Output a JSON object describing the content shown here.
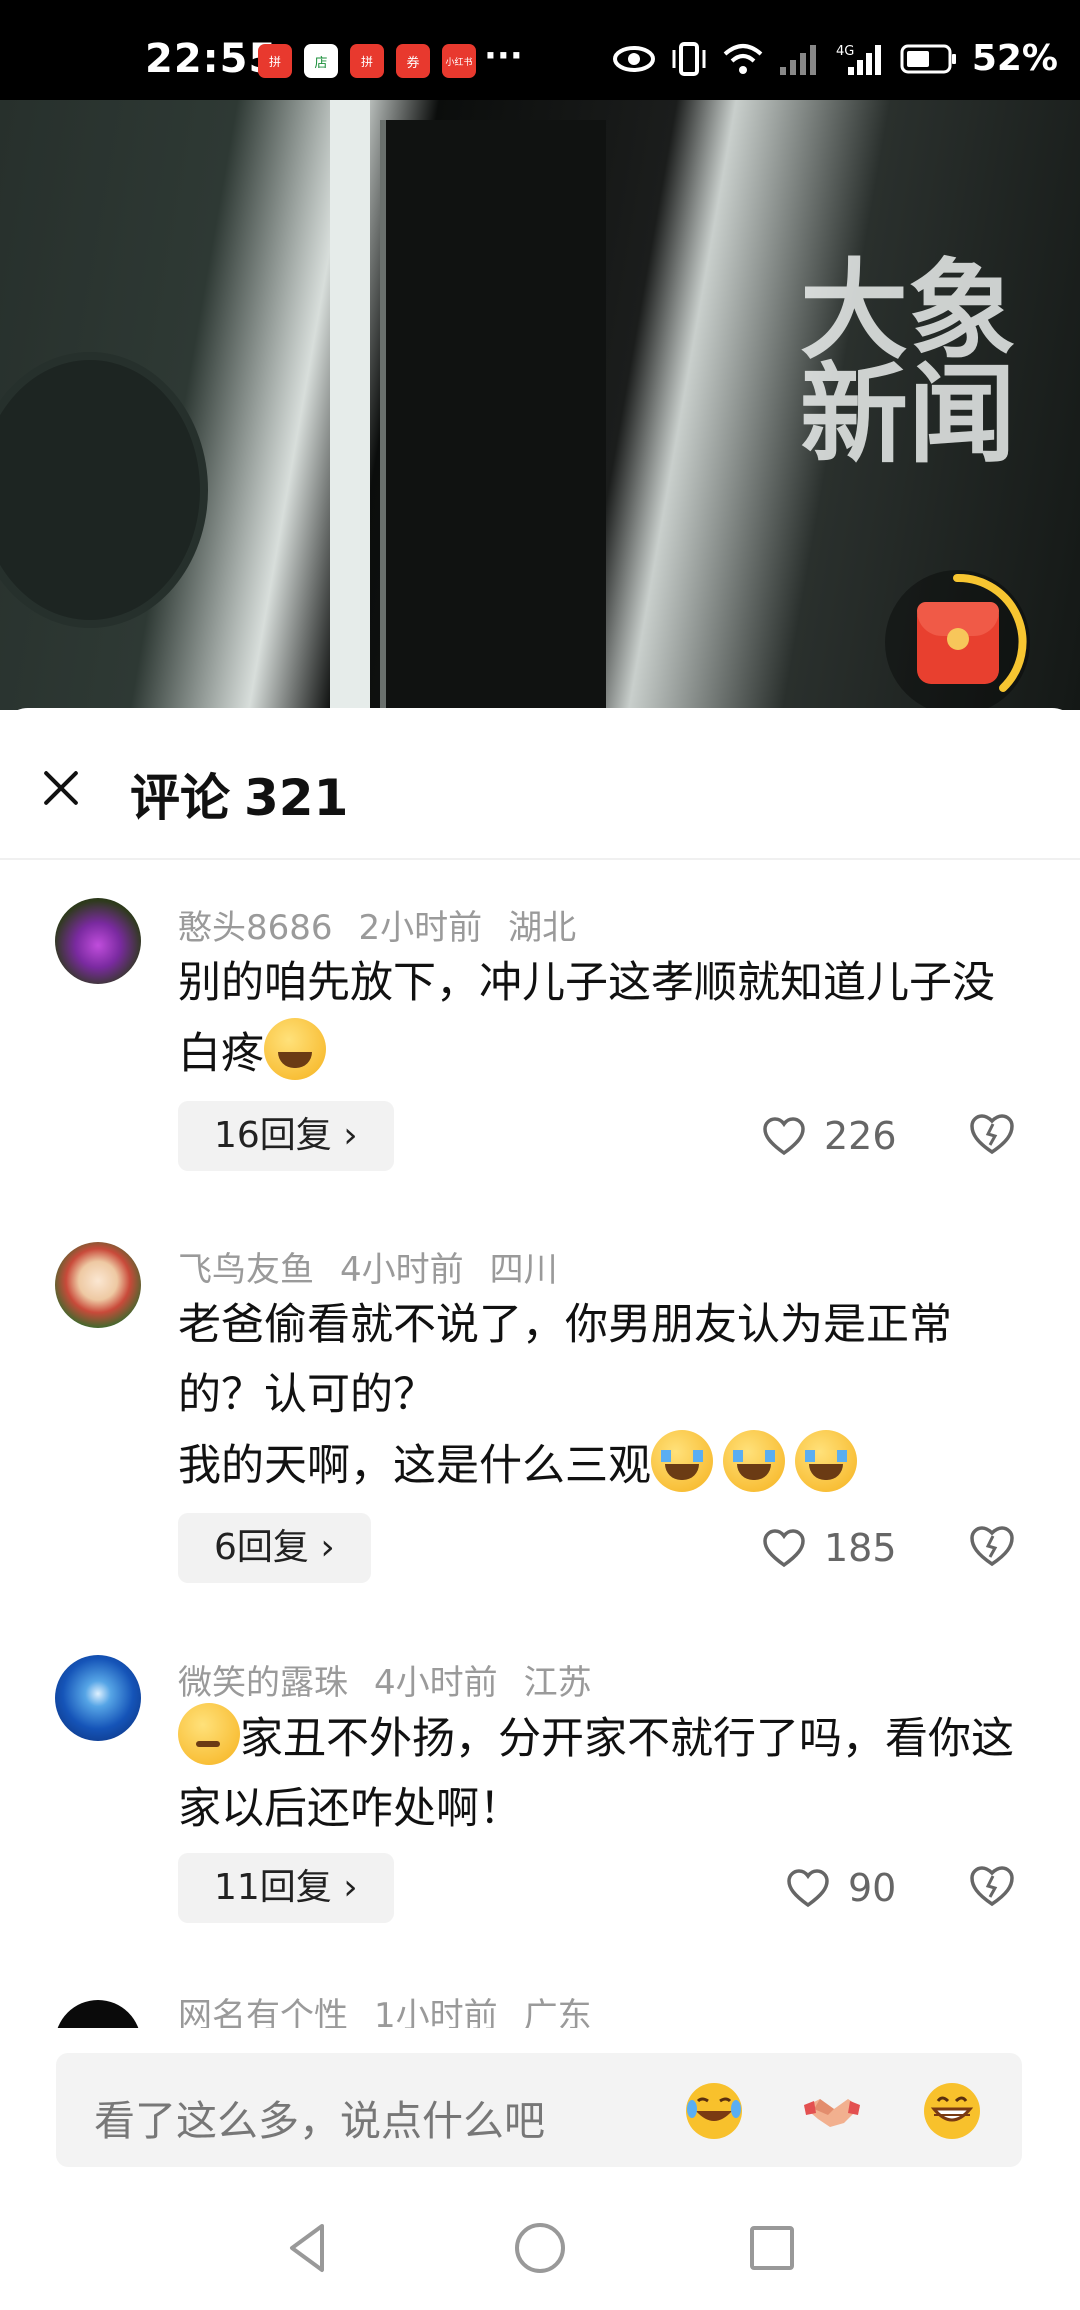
{
  "status_bar": {
    "time": "22:55",
    "apps": [
      "拼",
      "店",
      "拼",
      "券",
      "小红书"
    ],
    "more": "···",
    "battery": "52%"
  },
  "video": {
    "watermark": "大象新闻"
  },
  "comments_panel": {
    "title": "评论",
    "count": "321",
    "comments": [
      {
        "user": "憨头8686",
        "time": "2小时前",
        "location": "湖北",
        "text": "别的咱先放下，冲儿子这孝顺就知道儿子没白疼",
        "emoji": "laugh-cry",
        "replies": "16回复",
        "likes": "226"
      },
      {
        "user": "飞鸟友鱼",
        "time": "4小时前",
        "location": "四川",
        "text_line1": "老爸偷看就不说了，你男朋友认为是正常的？认可的？",
        "text_line2": "我的天啊，这是什么三观",
        "emoji": "cry",
        "replies": "6回复",
        "likes": "185"
      },
      {
        "user": "微笑的露珠",
        "time": "4小时前",
        "location": "江苏",
        "text": "家丑不外扬，分开家不就行了吗，看你这家以后还咋处啊！",
        "emoji": "thinking",
        "replies": "11回复",
        "likes": "90"
      },
      {
        "user": "网名有个性",
        "time": "1小时前",
        "location": "广东"
      }
    ]
  },
  "input": {
    "placeholder": "看了这么多，说点什么吧"
  },
  "colors": {
    "accent": "#e8402f",
    "muted_text": "#9a9a9a",
    "chip_bg": "#f2f2f2"
  }
}
